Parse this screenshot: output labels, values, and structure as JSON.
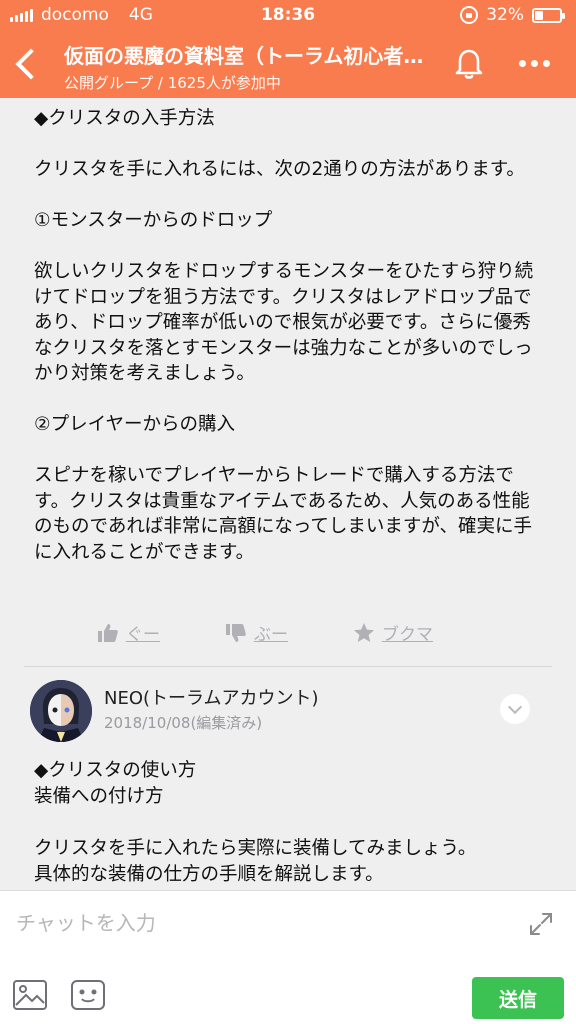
{
  "status_bar": {
    "carrier": "docomo",
    "network": "4G",
    "time": "18:36",
    "battery_percent": "32%",
    "battery_level": 0.32
  },
  "header": {
    "title": "仮面の悪魔の資料室（トーラム初心者…",
    "subtitle": "公開グループ / 1625人が参加中",
    "colors": {
      "background": "#f97c4e",
      "text": "#ffffff"
    },
    "icons": [
      "back-icon",
      "bell-icon",
      "more-icon"
    ]
  },
  "article": {
    "paragraphs": [
      "◆クリスタの入手方法",
      "クリスタを手に入れるには、次の2通りの方法があります。",
      "①モンスターからのドロップ",
      "欲しいクリスタをドロップするモンスターをひたすら狩り続けてドロップを狙う方法です。クリスタはレアドロップ品であり、ドロップ確率が低いので根気が必要です。さらに優秀なクリスタを落とすモンスターは強力なことが多いのでしっかり対策を考えましょう。",
      "②プレイヤーからの購入",
      "スピナを稼いでプレイヤーからトレードで購入する方法です。クリスタは貴重なアイテムであるため、人気のある性能のものであれば非常に高額になってしまいますが、確実に手に入れることができます。"
    ]
  },
  "actions": {
    "good_label": "ぐー",
    "bad_label": "ぶー",
    "bookmark_label": "ブクマ"
  },
  "post": {
    "author": "NEO(トーラムアカウント)",
    "date": "2018/10/08(編集済み)",
    "lines": [
      "◆クリスタの使い方",
      "装備への付け方",
      "クリスタを手に入れたら実際に装備してみましょう。",
      "具体的な装備の仕方の手順を解説します。"
    ]
  },
  "input_bar": {
    "placeholder": "チャットを入力",
    "send_label": "送信",
    "send_color": "#3cc252"
  }
}
